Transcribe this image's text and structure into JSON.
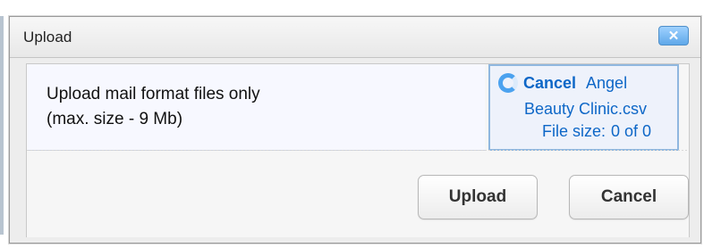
{
  "dialog": {
    "title": "Upload",
    "close_icon": "close-icon",
    "close_label": "✕"
  },
  "info": {
    "line1": "Upload mail format files only",
    "line2": "(max. size - 9 Mb)"
  },
  "upload_status": {
    "spinner_icon": "loading-spinner-icon",
    "cancel_label": "Cancel",
    "name_part_1": "Angel",
    "file_name": "Beauty Clinic.csv",
    "file_size_label": "File size:",
    "file_size_value": "0 of 0"
  },
  "actions": {
    "upload_label": "Upload",
    "cancel_label": "Cancel"
  },
  "colors": {
    "accent": "#0e67c7",
    "close_button": "#5fa8e9",
    "status_border": "#8fb7df"
  }
}
